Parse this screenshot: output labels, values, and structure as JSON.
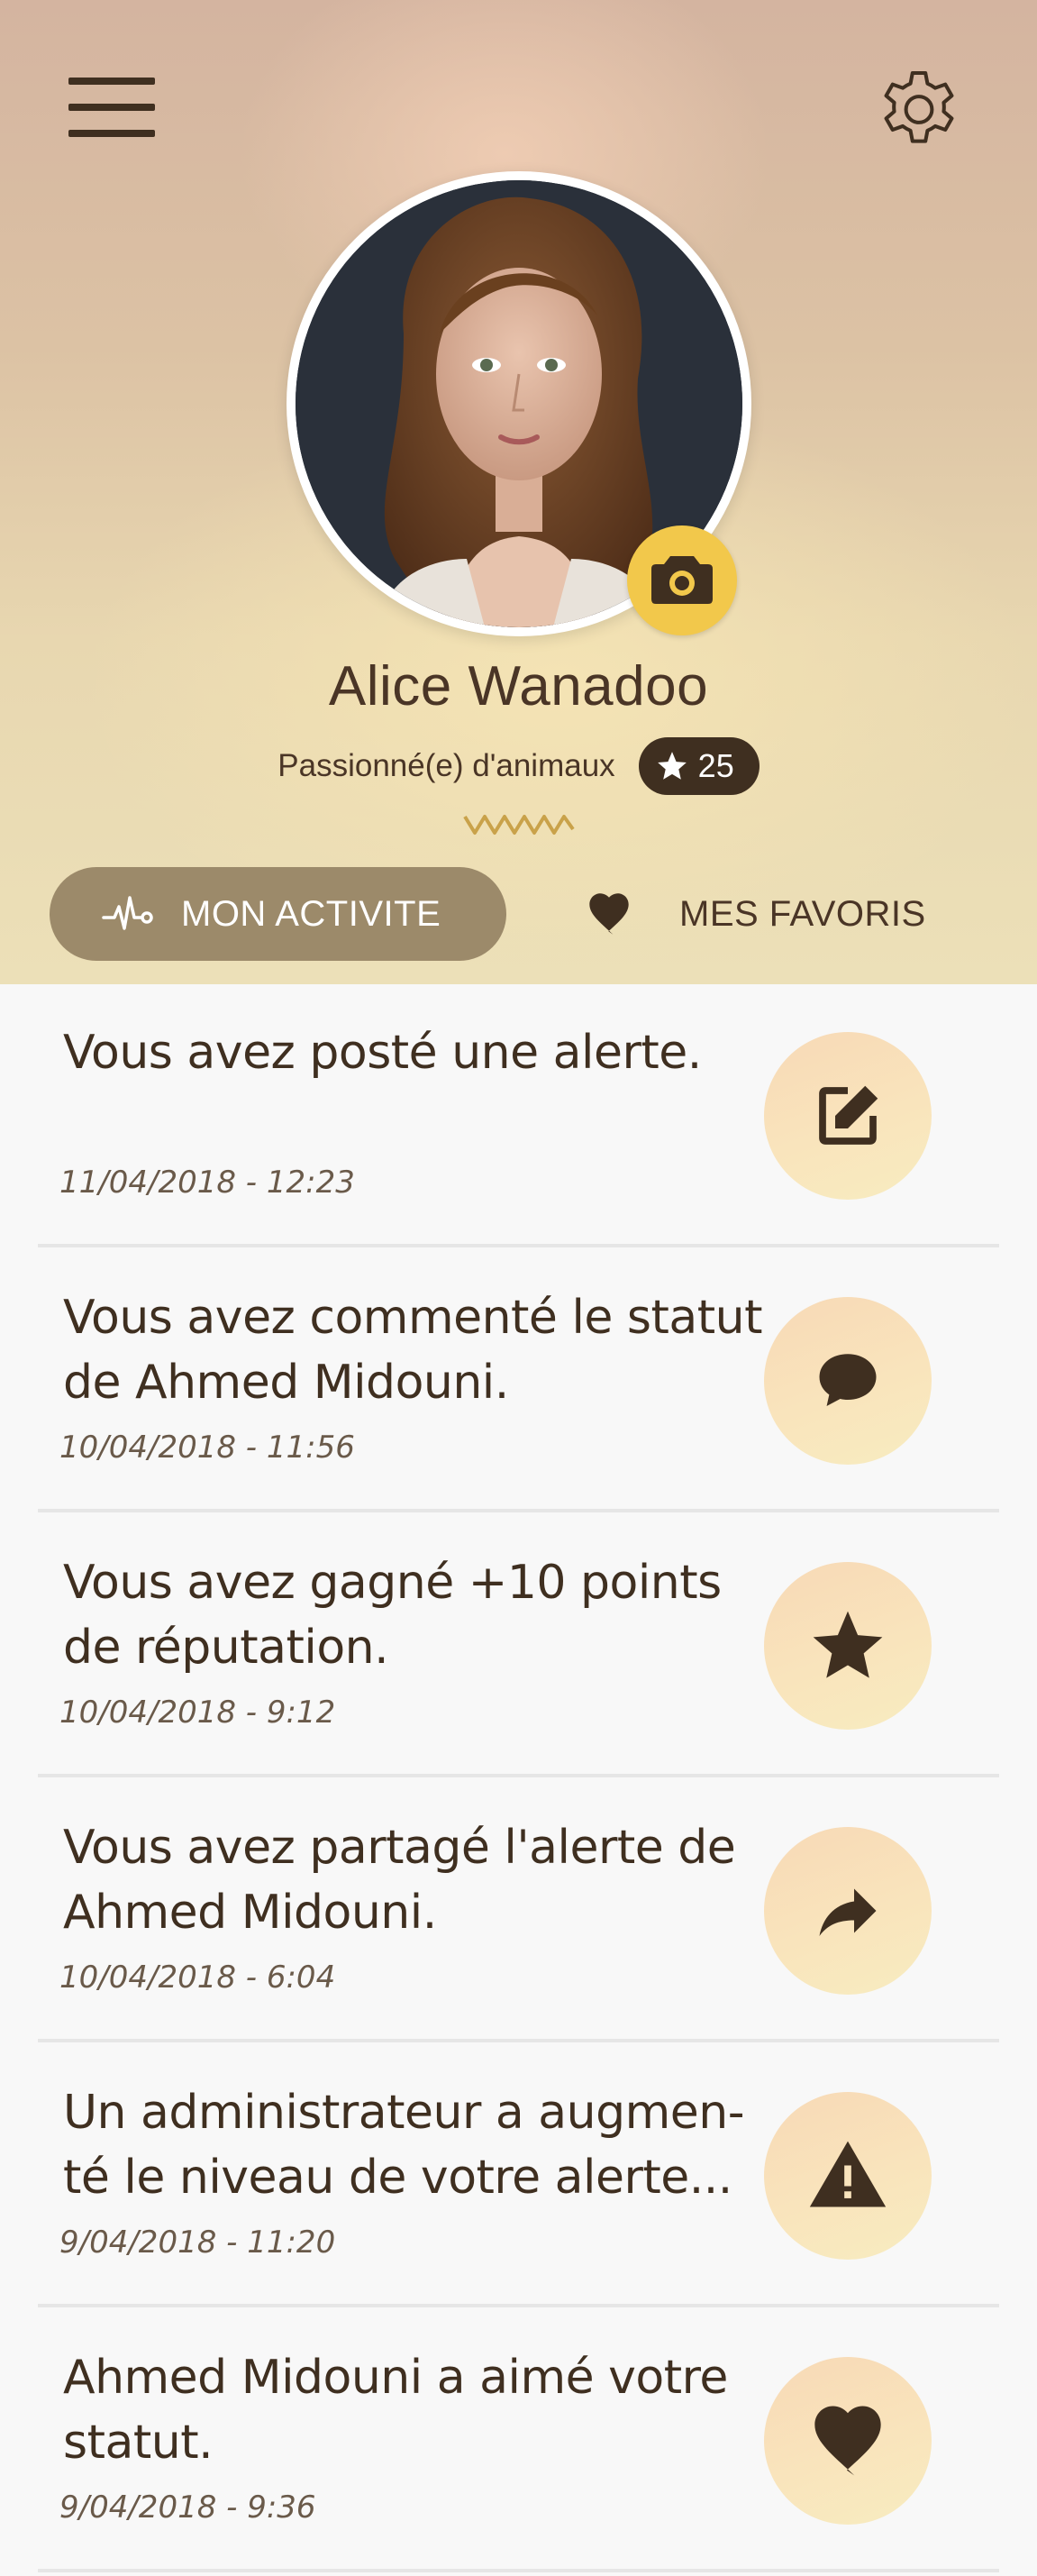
{
  "profile": {
    "name": "Alice Wanadoo",
    "role": "Passionné(e) d'animaux",
    "reputation": "25"
  },
  "tabs": {
    "activity_label": "MON ACTIVITE",
    "favorites_label": "MES FAVORIS",
    "active": "activity"
  },
  "activities": [
    {
      "text": "Vous avez posté une alerte.",
      "date": "11/04/2018 - 12:23",
      "icon": "edit-icon"
    },
    {
      "text": "Vous avez commenté le statut de Ahmed Midouni.",
      "date": "10/04/2018 - 11:56",
      "icon": "comment-icon"
    },
    {
      "text": "Vous avez gagné +10 points de réputation.",
      "date": "10/04/2018 - 9:12",
      "icon": "star-icon"
    },
    {
      "text": "Vous avez partagé l'alerte de Ahmed Midouni.",
      "date": "10/04/2018 - 6:04",
      "icon": "share-icon"
    },
    {
      "text": "Un administrateur a augmen-té le niveau de votre alerte...",
      "date": "9/04/2018 - 11:20",
      "icon": "warning-icon"
    },
    {
      "text": "Ahmed Midouni a aimé votre statut.",
      "date": "9/04/2018 - 9:36",
      "icon": "heart-icon"
    }
  ],
  "colors": {
    "accent": "#f2c84b",
    "dark": "#3f2f20",
    "tab_active_bg": "#9c8a6a",
    "list_bg": "#f8f8f8"
  }
}
